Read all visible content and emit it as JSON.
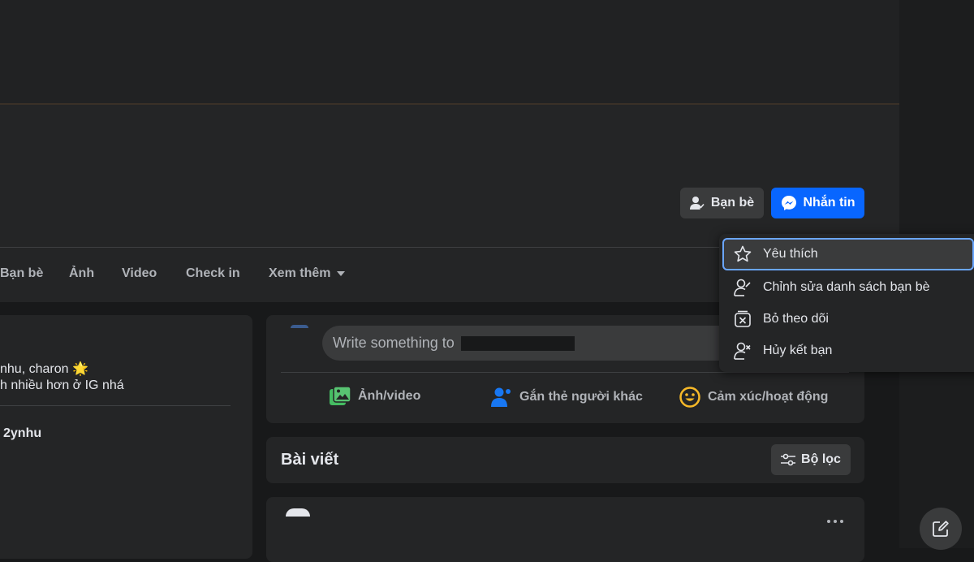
{
  "profile_actions": {
    "friends_label": "Bạn bè",
    "message_label": "Nhắn tin"
  },
  "tabs": {
    "friends": "Bạn bè",
    "photos": "Ảnh",
    "video": "Video",
    "checkin": "Check in",
    "more": "Xem thêm"
  },
  "intro": {
    "line1": "nhu, charon 🌟",
    "line2": "h nhiều hơn ở IG nhá",
    "name": "2ynhu"
  },
  "composer": {
    "placeholder": "Write something to",
    "actions": {
      "photo_video": "Ảnh/video",
      "tag_people": "Gắn thẻ người khác",
      "feeling": "Cảm xúc/hoạt động"
    }
  },
  "posts": {
    "title": "Bài viết",
    "filter_label": "Bộ lọc"
  },
  "friend_menu": {
    "items": [
      {
        "label": "Yêu thích",
        "icon": "star-icon"
      },
      {
        "label": "Chỉnh sửa danh sách bạn bè",
        "icon": "person-edit-icon"
      },
      {
        "label": "Bỏ theo dõi",
        "icon": "unfollow-icon"
      },
      {
        "label": "Hủy kết bạn",
        "icon": "person-remove-icon"
      }
    ]
  },
  "colors": {
    "accent": "#0866ff",
    "surface": "#242526",
    "background": "#18191a",
    "control": "#3a3b3c",
    "focus_ring": "#6aa6ff"
  }
}
